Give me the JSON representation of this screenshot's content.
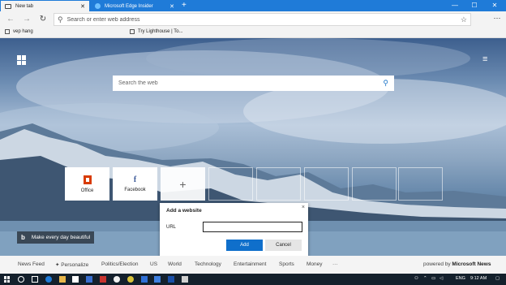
{
  "tabs": [
    {
      "label": "New tab",
      "active": true
    },
    {
      "label": "Microsoft Edge Insider",
      "active": false
    }
  ],
  "new_tab_symbol": "+",
  "window_controls": {
    "minimize": "—",
    "maximize": "☐",
    "close": "✕"
  },
  "toolbar": {
    "back": "←",
    "forward": "→",
    "refresh": "↻",
    "address_placeholder": "Search or enter web address",
    "favorite_star": "☆",
    "menu": "⋯"
  },
  "favorites": [
    {
      "label": "vep hang"
    },
    {
      "label": "Try Lighthouse | To..."
    }
  ],
  "page": {
    "hamburger": "≡",
    "search_placeholder": "Search the web",
    "search_icon": "⚲",
    "tiles": [
      {
        "label": "Office",
        "icon": "office-icon"
      },
      {
        "label": "Facebook",
        "icon": "facebook-icon",
        "glyph": "f"
      },
      {
        "label": "",
        "icon": "add-icon",
        "glyph": "+"
      }
    ],
    "bing": {
      "logo": "b",
      "caption": "Make every day beautiful"
    }
  },
  "dialog": {
    "title": "Add a website",
    "close": "×",
    "url_label": "URL",
    "url_value": "",
    "add_label": "Add",
    "cancel_label": "Cancel"
  },
  "newsbar": {
    "items": [
      "News Feed",
      "Personalize",
      "Politics/Election",
      "US",
      "World",
      "Technology",
      "Entertainment",
      "Sports",
      "Money",
      "···"
    ],
    "powered_prefix": "powered by",
    "powered_brand": "Microsoft News"
  },
  "taskbar": {
    "language": "ENG",
    "time": "9:12 AM"
  },
  "colors": {
    "titlebar": "#1f7bd8",
    "accent": "#0f6fcb",
    "office": "#d83b01",
    "facebook": "#3b5998",
    "taskbar": "#14202c"
  }
}
